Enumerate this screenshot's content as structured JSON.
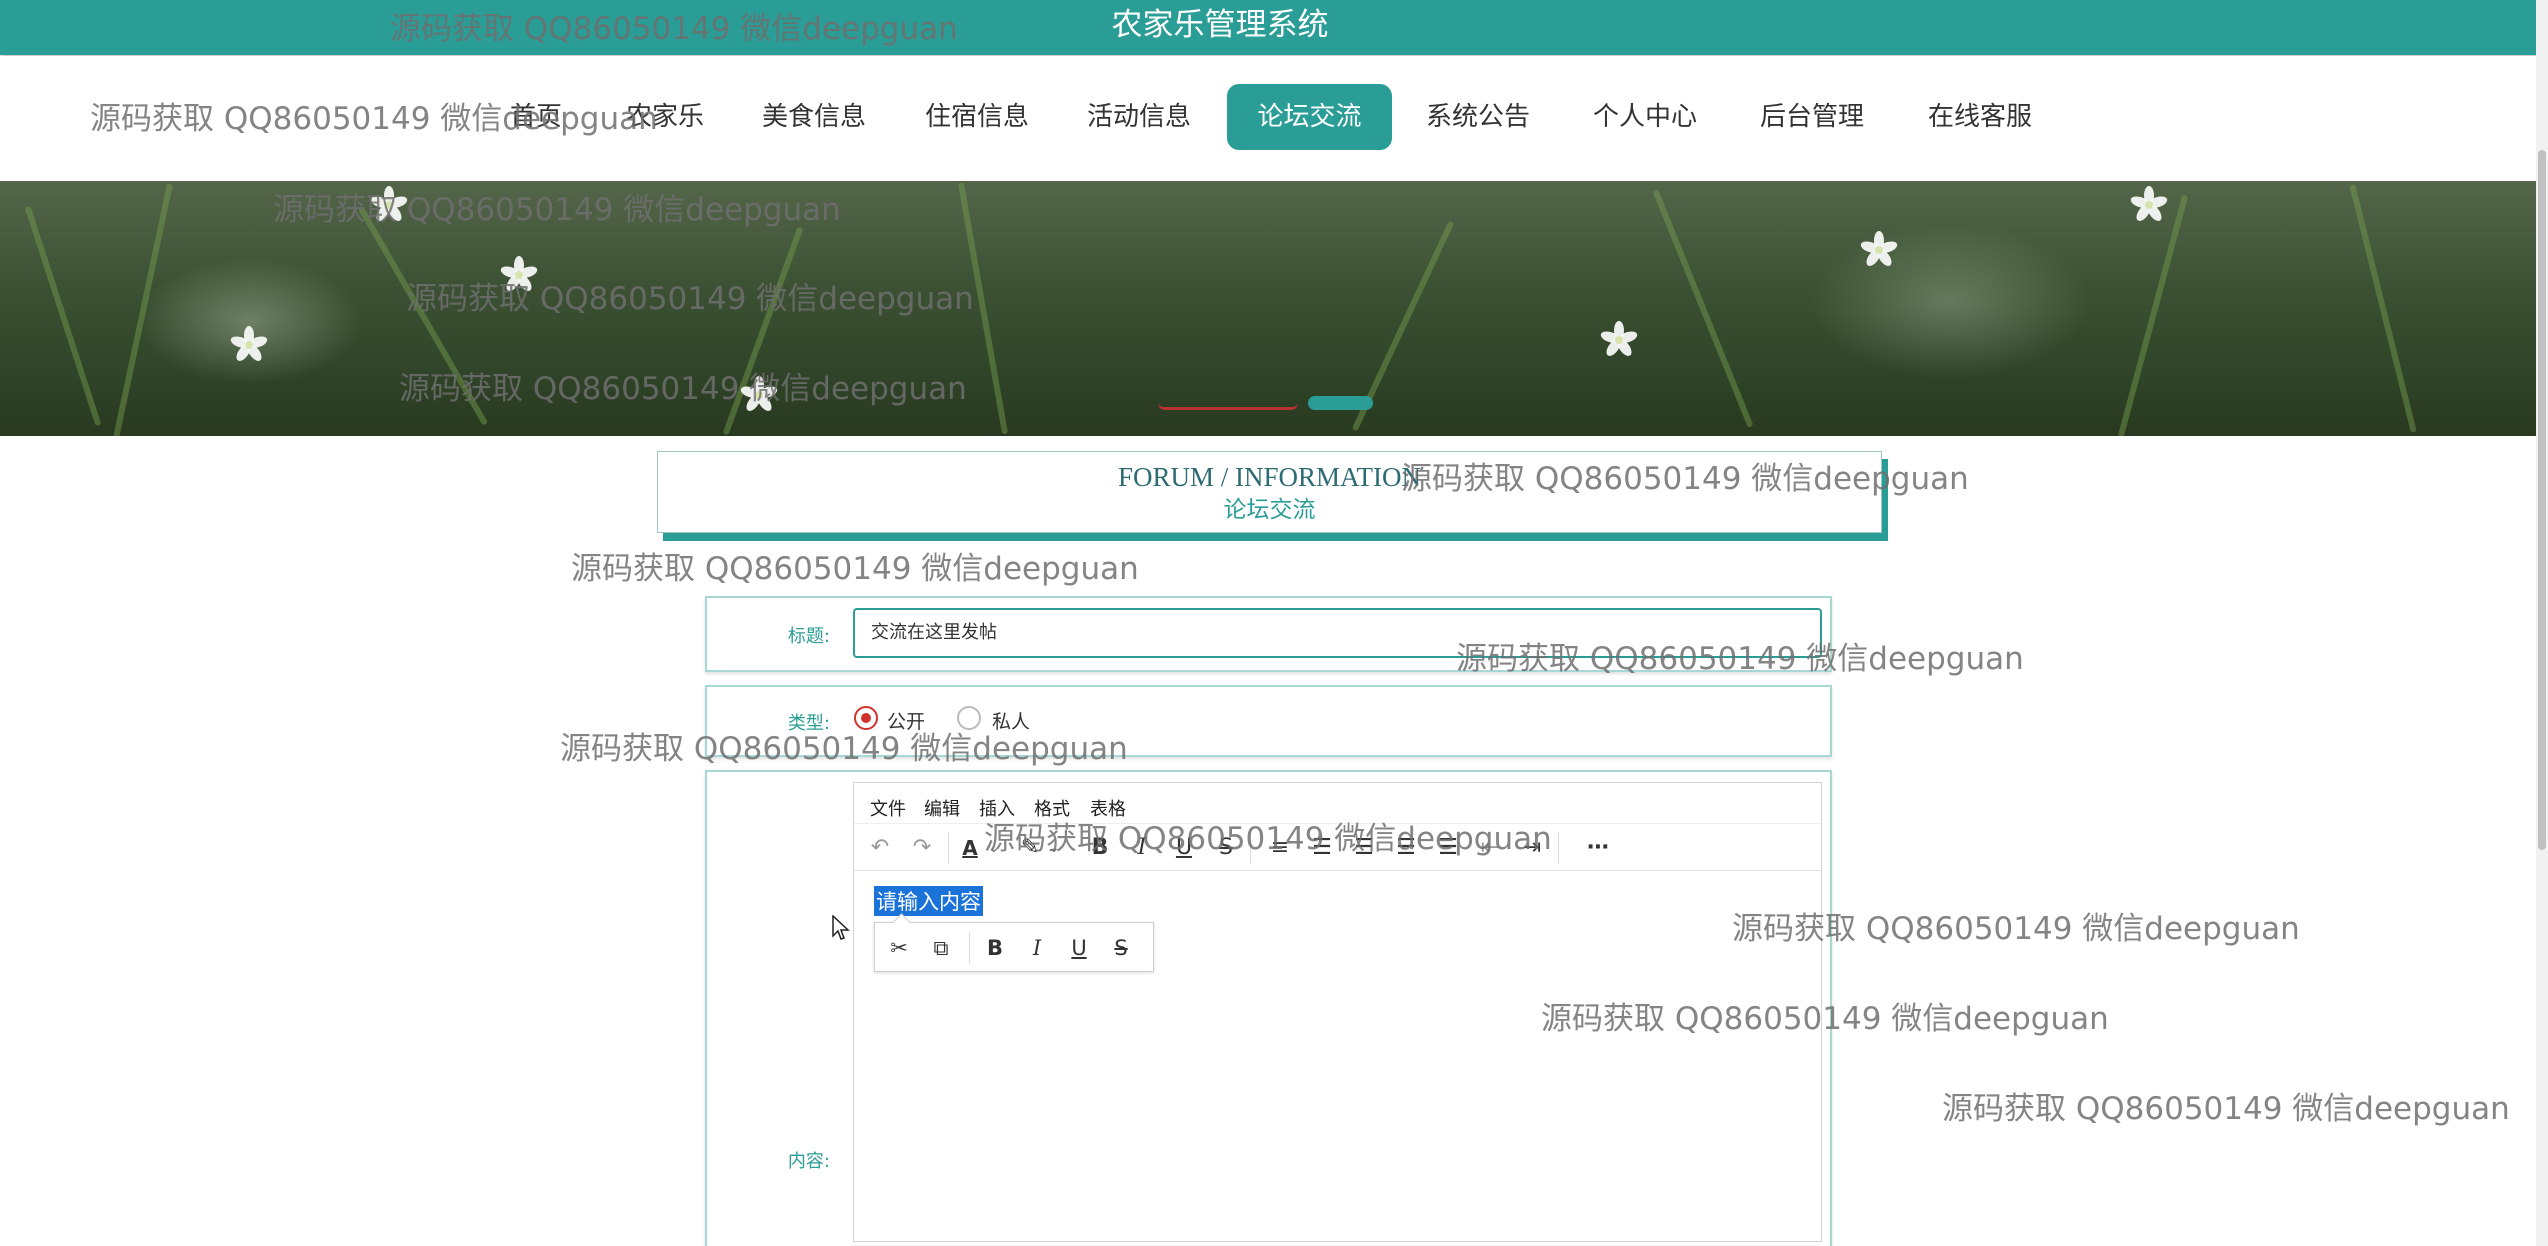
{
  "header": {
    "system_title": "农家乐管理系统"
  },
  "nav": {
    "items": [
      {
        "label": "首页"
      },
      {
        "label": "农家乐"
      },
      {
        "label": "美食信息"
      },
      {
        "label": "住宿信息"
      },
      {
        "label": "活动信息"
      },
      {
        "label": "论坛交流",
        "active": true
      },
      {
        "label": "系统公告"
      },
      {
        "label": "个人中心"
      },
      {
        "label": "后台管理"
      },
      {
        "label": "在线客服"
      }
    ]
  },
  "banner": {
    "active_dot_index": 1,
    "dot_colors": [
      "#b8332f",
      "#2a9d96"
    ]
  },
  "section": {
    "title_en": "FORUM / INFORMATION",
    "title_cn": "论坛交流"
  },
  "form": {
    "title_label": "标题:",
    "title_value": "交流在这里发帖",
    "type_label": "类型:",
    "type_options": [
      {
        "label": "公开",
        "checked": true
      },
      {
        "label": "私人",
        "checked": false
      }
    ],
    "content_label": "内容:",
    "editor": {
      "menus": [
        "文件",
        "编辑",
        "插入",
        "格式",
        "表格"
      ],
      "placeholder": "请输入内容"
    }
  },
  "watermark": {
    "text": "源码获取 QQ86050149 微信deepguan"
  },
  "colors": {
    "accent": "#2a9d96",
    "radio_checked": "#d0322c",
    "selection": "#1a73d9"
  }
}
